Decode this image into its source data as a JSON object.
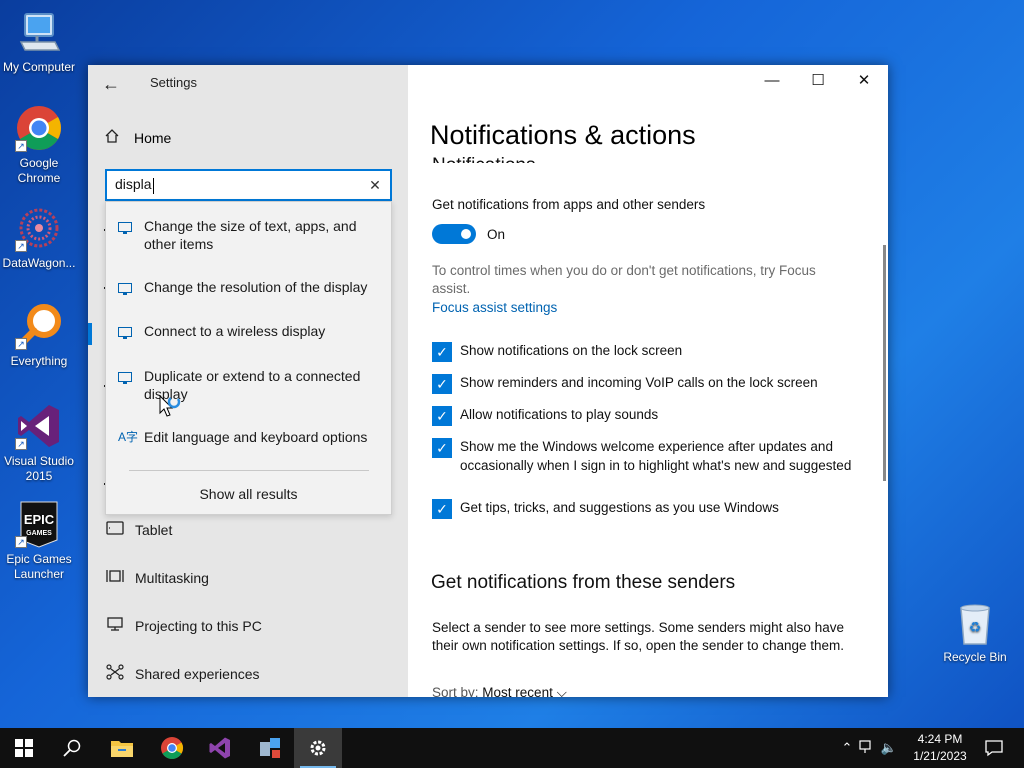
{
  "desktop": {
    "icons": [
      {
        "label": "My Computer",
        "icon": "computer-icon"
      },
      {
        "label": "Google Chrome",
        "icon": "chrome-icon"
      },
      {
        "label": "DataWagon...",
        "icon": "datawagon-icon"
      },
      {
        "label": "Everything",
        "icon": "everything-search-icon"
      },
      {
        "label": "Visual Studio 2015",
        "icon": "visual-studio-icon"
      },
      {
        "label": "Epic Games Launcher",
        "icon": "epic-games-icon",
        "logo_text": "EPIC GAMES"
      }
    ],
    "recycle_bin": {
      "label": "Recycle Bin",
      "icon": "recycle-bin-icon"
    }
  },
  "window": {
    "title": "Settings",
    "back_icon": "back-arrow-icon",
    "controls": {
      "minimize": "—",
      "maximize": "☐",
      "close": "✕"
    }
  },
  "sidebar": {
    "home_label": "Home",
    "search": {
      "value": "displa"
    },
    "nav_items": [
      {
        "label": "Tablet",
        "icon": "tablet-icon"
      },
      {
        "label": "Multitasking",
        "icon": "multitasking-icon"
      },
      {
        "label": "Projecting to this PC",
        "icon": "projecting-icon"
      },
      {
        "label": "Shared experiences",
        "icon": "shared-experiences-icon"
      }
    ]
  },
  "search_results": {
    "items": [
      {
        "label": "Change the size of text, apps, and other items",
        "icon": "monitor-icon"
      },
      {
        "label": "Change the resolution of the display",
        "icon": "monitor-icon"
      },
      {
        "label": "Connect to a wireless display",
        "icon": "monitor-icon"
      },
      {
        "label": "Duplicate or extend to a connected display",
        "icon": "monitor-icon"
      },
      {
        "label": "Edit language and keyboard options",
        "icon": "language-icon"
      }
    ],
    "show_all": "Show all results"
  },
  "main": {
    "title": "Notifications & actions",
    "section_partial": "Notifications",
    "get_notifications_label": "Get notifications from apps and other senders",
    "toggle_state": "On",
    "focus_desc": "To control times when you do or don't get notifications, try Focus assist.",
    "focus_link": "Focus assist settings",
    "checkboxes": [
      {
        "label": "Show notifications on the lock screen",
        "checked": true
      },
      {
        "label": "Show reminders and incoming VoIP calls on the lock screen",
        "checked": true
      },
      {
        "label": "Allow notifications to play sounds",
        "checked": true
      },
      {
        "label": "Show me the Windows welcome experience after updates and occasionally when I sign in to highlight what's new and suggested",
        "checked": true
      },
      {
        "label": "Get tips, tricks, and suggestions as you use Windows",
        "checked": true
      }
    ],
    "senders_heading": "Get notifications from these senders",
    "senders_desc": "Select a sender to see more settings. Some senders might also have their own notification settings. If so, open the sender to change them.",
    "sort_label": "Sort by:",
    "sort_value": "Most recent"
  },
  "taskbar": {
    "apps": [
      "start-icon",
      "search-icon",
      "file-explorer-icon",
      "chrome-icon",
      "visual-studio-icon",
      "network-tool-icon",
      "settings-gear-icon"
    ],
    "clock_time": "4:24 PM",
    "clock_date": "1/21/2023"
  },
  "colors": {
    "accent": "#0078d7",
    "link": "#0063b1"
  }
}
